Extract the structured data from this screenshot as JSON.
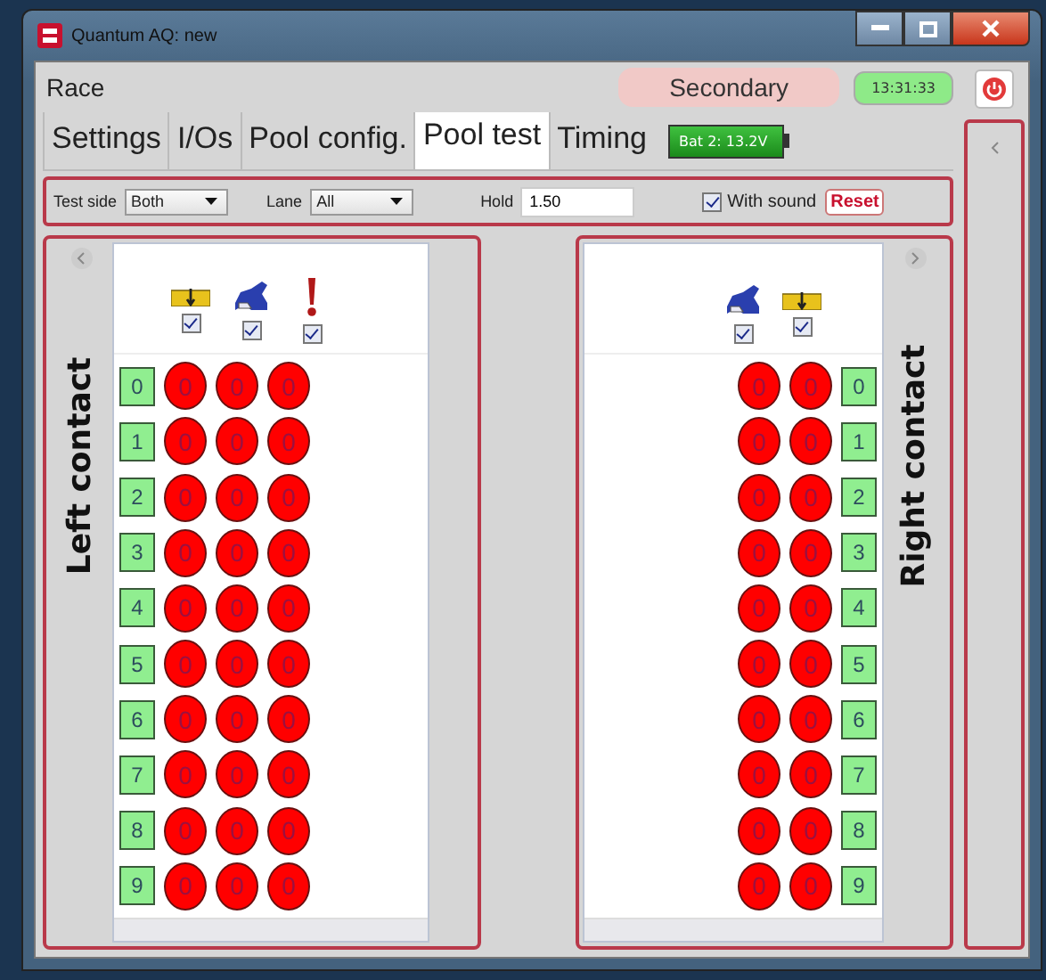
{
  "window": {
    "title": "Quantum AQ: new"
  },
  "header": {
    "section": "Race",
    "mode": "Secondary",
    "clock": "13:31:33"
  },
  "tabs": [
    {
      "label": "Settings",
      "selected": false
    },
    {
      "label": "I/Os",
      "selected": false
    },
    {
      "label": "Pool config.",
      "selected": false
    },
    {
      "label": "Pool test",
      "selected": true
    },
    {
      "label": "Timing",
      "selected": false
    }
  ],
  "battery": {
    "label": "Bat 2: 13.2V"
  },
  "test_bar": {
    "test_side_label": "Test side",
    "test_side": "Both",
    "lane_label": "Lane",
    "lane": "All",
    "hold_label": "Hold",
    "hold": "1.50",
    "with_sound": {
      "label": "With sound",
      "checked": true
    },
    "reset": "Reset"
  },
  "left_contact": {
    "title": "Left contact",
    "sensors": [
      {
        "kind": "pad",
        "checked": true
      },
      {
        "kind": "shoe",
        "checked": true
      },
      {
        "kind": "pin",
        "checked": true
      }
    ],
    "lanes": [
      {
        "lane": "0",
        "counts": [
          "0",
          "0",
          "0"
        ]
      },
      {
        "lane": "1",
        "counts": [
          "0",
          "0",
          "0"
        ]
      },
      {
        "lane": "2",
        "counts": [
          "0",
          "0",
          "0"
        ]
      },
      {
        "lane": "3",
        "counts": [
          "0",
          "0",
          "0"
        ]
      },
      {
        "lane": "4",
        "counts": [
          "0",
          "0",
          "0"
        ]
      },
      {
        "lane": "5",
        "counts": [
          "0",
          "0",
          "0"
        ]
      },
      {
        "lane": "6",
        "counts": [
          "0",
          "0",
          "0"
        ]
      },
      {
        "lane": "7",
        "counts": [
          "0",
          "0",
          "0"
        ]
      },
      {
        "lane": "8",
        "counts": [
          "0",
          "0",
          "0"
        ]
      },
      {
        "lane": "9",
        "counts": [
          "0",
          "0",
          "0"
        ]
      }
    ]
  },
  "right_contact": {
    "title": "Right contact",
    "sensors": [
      {
        "kind": "shoe",
        "checked": true
      },
      {
        "kind": "pad",
        "checked": true
      }
    ],
    "lanes": [
      {
        "lane": "0",
        "counts": [
          "0",
          "0"
        ]
      },
      {
        "lane": "1",
        "counts": [
          "0",
          "0"
        ]
      },
      {
        "lane": "2",
        "counts": [
          "0",
          "0"
        ]
      },
      {
        "lane": "3",
        "counts": [
          "0",
          "0"
        ]
      },
      {
        "lane": "4",
        "counts": [
          "0",
          "0"
        ]
      },
      {
        "lane": "5",
        "counts": [
          "0",
          "0"
        ]
      },
      {
        "lane": "6",
        "counts": [
          "0",
          "0"
        ]
      },
      {
        "lane": "7",
        "counts": [
          "0",
          "0"
        ]
      },
      {
        "lane": "8",
        "counts": [
          "0",
          "0"
        ]
      },
      {
        "lane": "9",
        "counts": [
          "0",
          "0"
        ]
      }
    ]
  }
}
